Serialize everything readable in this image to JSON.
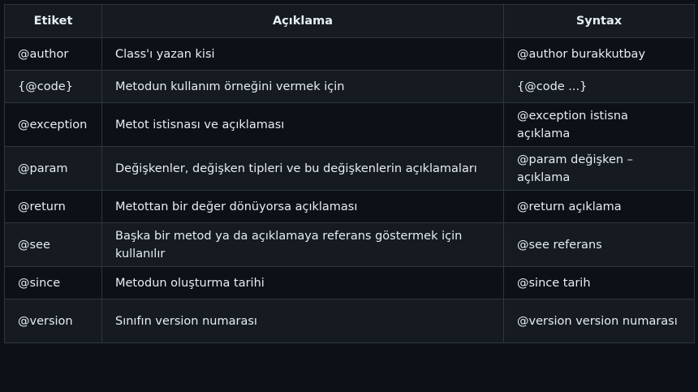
{
  "table": {
    "headers": [
      "Etiket",
      "Açıklama",
      "Syntax"
    ],
    "rows": [
      {
        "tag": "@author",
        "desc": "Class'ı yazan kisi",
        "syntax": "@author burakkutbay"
      },
      {
        "tag": "{@code}",
        "desc": "Metodun kullanım örneğini vermek için",
        "syntax": "{@code ...}"
      },
      {
        "tag": "@exception",
        "desc": "Metot istisnası ve açıklaması",
        "syntax": "@exception istisna açıklama"
      },
      {
        "tag": "@param",
        "desc": "Değişkenler, değişken tipleri ve bu değişkenlerin açıklamaları",
        "syntax": "@param değişken – açıklama"
      },
      {
        "tag": "@return",
        "desc": "Metottan bir değer dönüyorsa açıklaması",
        "syntax": "@return açıklama"
      },
      {
        "tag": "@see",
        "desc": "Başka bir metod ya da açıklamaya referans göstermek için kullanılır",
        "syntax": "@see referans"
      },
      {
        "tag": "@since",
        "desc": "Metodun oluşturma tarihi",
        "syntax": "@since tarih"
      },
      {
        "tag": "@version",
        "desc": "Sınıfın version numarası",
        "syntax": "@version version numarası"
      }
    ]
  }
}
